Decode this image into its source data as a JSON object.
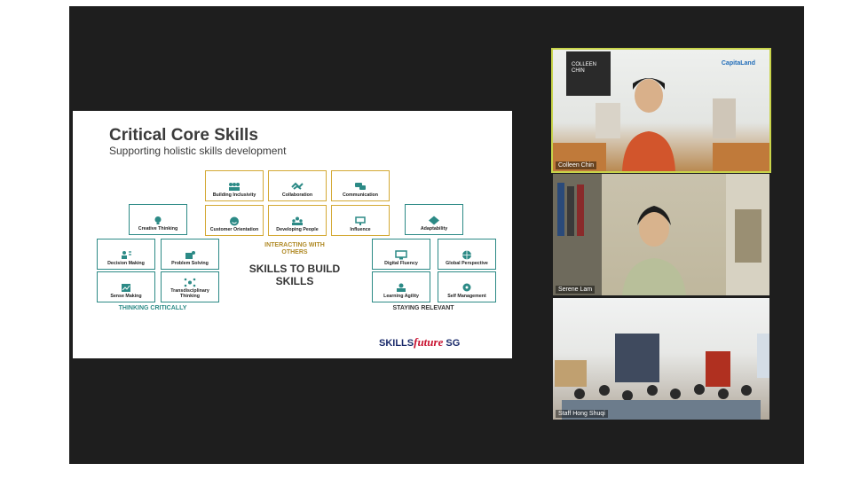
{
  "slide": {
    "title": "Critical Core Skills",
    "subtitle": "Supporting holistic skills development",
    "tiles": {
      "building_inclusivity": "Building Inclusivity",
      "collaboration": "Collaboration",
      "communication": "Communication",
      "customer_orientation": "Customer Orientation",
      "developing_people": "Developing People",
      "influence": "Influence",
      "creative_thinking": "Creative Thinking",
      "decision_making": "Decision Making",
      "problem_solving": "Problem Solving",
      "sense_making": "Sense Making",
      "transdisciplinary_thinking": "Transdisciplinary Thinking",
      "adaptability": "Adaptability",
      "digital_fluency": "Digital Fluency",
      "global_perspective": "Global Perspective",
      "learning_agility": "Learning Agility",
      "self_management": "Self Management"
    },
    "categories": {
      "thinking": "THINKING CRITICALLY",
      "interacting": "INTERACTING WITH OTHERS",
      "staying": "STAYING RELEVANT"
    },
    "center_label": "SKILLS TO BUILD SKILLS",
    "brand": {
      "skills": "SKILLS",
      "future": "future",
      "sg": " SG"
    }
  },
  "participants": [
    {
      "name": "Colleen Chin",
      "nameplate": "COLLEEN CHIN",
      "logo": "CapitaLand"
    },
    {
      "name": "Serene Lam"
    },
    {
      "name": "Staff Hong Shuqi"
    }
  ],
  "colors": {
    "teal": "#2c8a86",
    "gold": "#d4a935",
    "active_speaker": "#c8d44a",
    "background": "#1e1e1e"
  }
}
